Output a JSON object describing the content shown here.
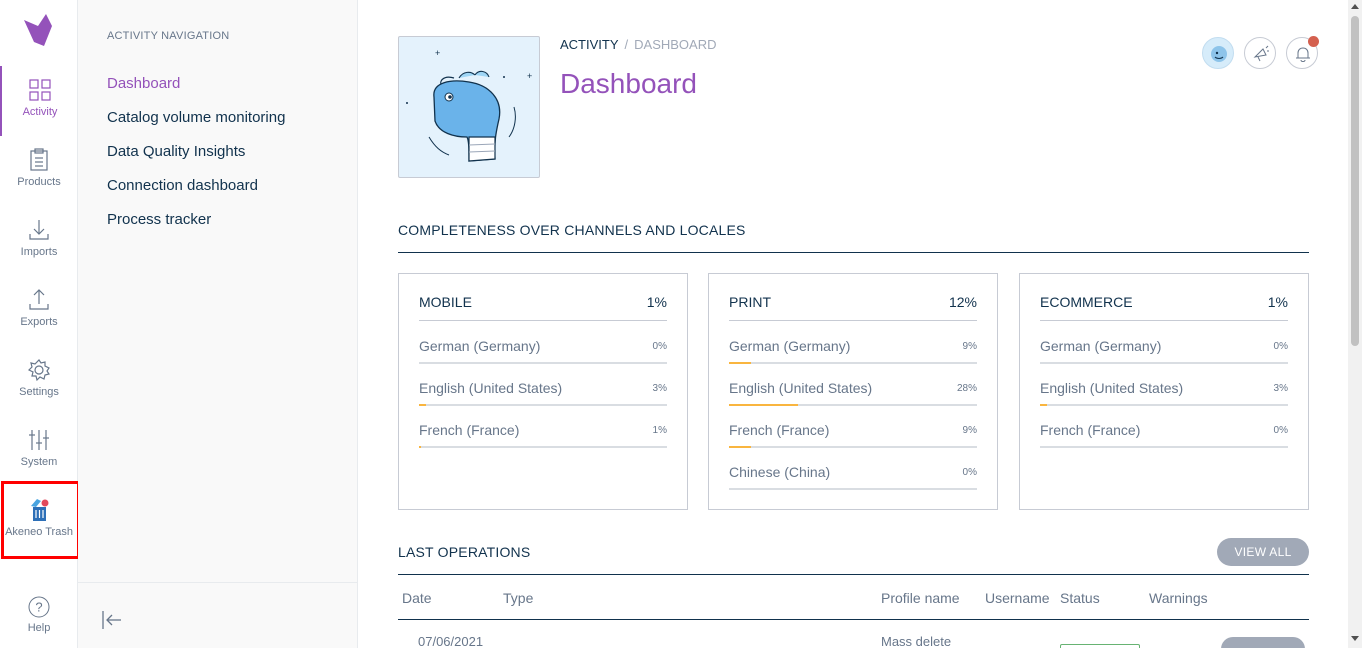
{
  "main_nav": {
    "items": [
      {
        "label": "Activity",
        "icon": "activity-icon",
        "active": true
      },
      {
        "label": "Products",
        "icon": "products-icon"
      },
      {
        "label": "Imports",
        "icon": "imports-icon"
      },
      {
        "label": "Exports",
        "icon": "exports-icon"
      },
      {
        "label": "Settings",
        "icon": "settings-icon"
      },
      {
        "label": "System",
        "icon": "system-icon"
      },
      {
        "label": "Akeneo Trash",
        "icon": "trash-icon"
      }
    ],
    "help_label": "Help"
  },
  "sub_nav": {
    "title": "ACTIVITY NAVIGATION",
    "links": [
      {
        "label": "Dashboard",
        "active": true
      },
      {
        "label": "Catalog volume monitoring"
      },
      {
        "label": "Data Quality Insights"
      },
      {
        "label": "Connection dashboard"
      },
      {
        "label": "Process tracker"
      }
    ]
  },
  "header": {
    "breadcrumb": [
      "ACTIVITY",
      "/",
      "DASHBOARD"
    ],
    "title": "Dashboard"
  },
  "completeness": {
    "title": "COMPLETENESS OVER CHANNELS AND LOCALES",
    "channels": [
      {
        "name": "MOBILE",
        "percent": "1%",
        "locales": [
          {
            "name": "German (Germany)",
            "percent": "0%",
            "value": 0
          },
          {
            "name": "English (United States)",
            "percent": "3%",
            "value": 3
          },
          {
            "name": "French (France)",
            "percent": "1%",
            "value": 1
          }
        ]
      },
      {
        "name": "PRINT",
        "percent": "12%",
        "locales": [
          {
            "name": "German (Germany)",
            "percent": "9%",
            "value": 9
          },
          {
            "name": "English (United States)",
            "percent": "28%",
            "value": 28
          },
          {
            "name": "French (France)",
            "percent": "9%",
            "value": 9
          },
          {
            "name": "Chinese (China)",
            "percent": "0%",
            "value": 0
          }
        ]
      },
      {
        "name": "ECOMMERCE",
        "percent": "1%",
        "locales": [
          {
            "name": "German (Germany)",
            "percent": "0%",
            "value": 0
          },
          {
            "name": "English (United States)",
            "percent": "3%",
            "value": 3
          },
          {
            "name": "French (France)",
            "percent": "0%",
            "value": 0
          }
        ]
      }
    ]
  },
  "operations": {
    "title": "LAST OPERATIONS",
    "view_all_label": "VIEW ALL",
    "columns": [
      "Date",
      "Type",
      "Profile name",
      "Username",
      "Status",
      "Warnings"
    ],
    "first_row": {
      "date": "07/06/2021",
      "profile_name": "Mass delete"
    }
  },
  "colors": {
    "accent": "#9452ba",
    "highlight_outline": "#ff0000",
    "progress": "#f9b53f"
  }
}
